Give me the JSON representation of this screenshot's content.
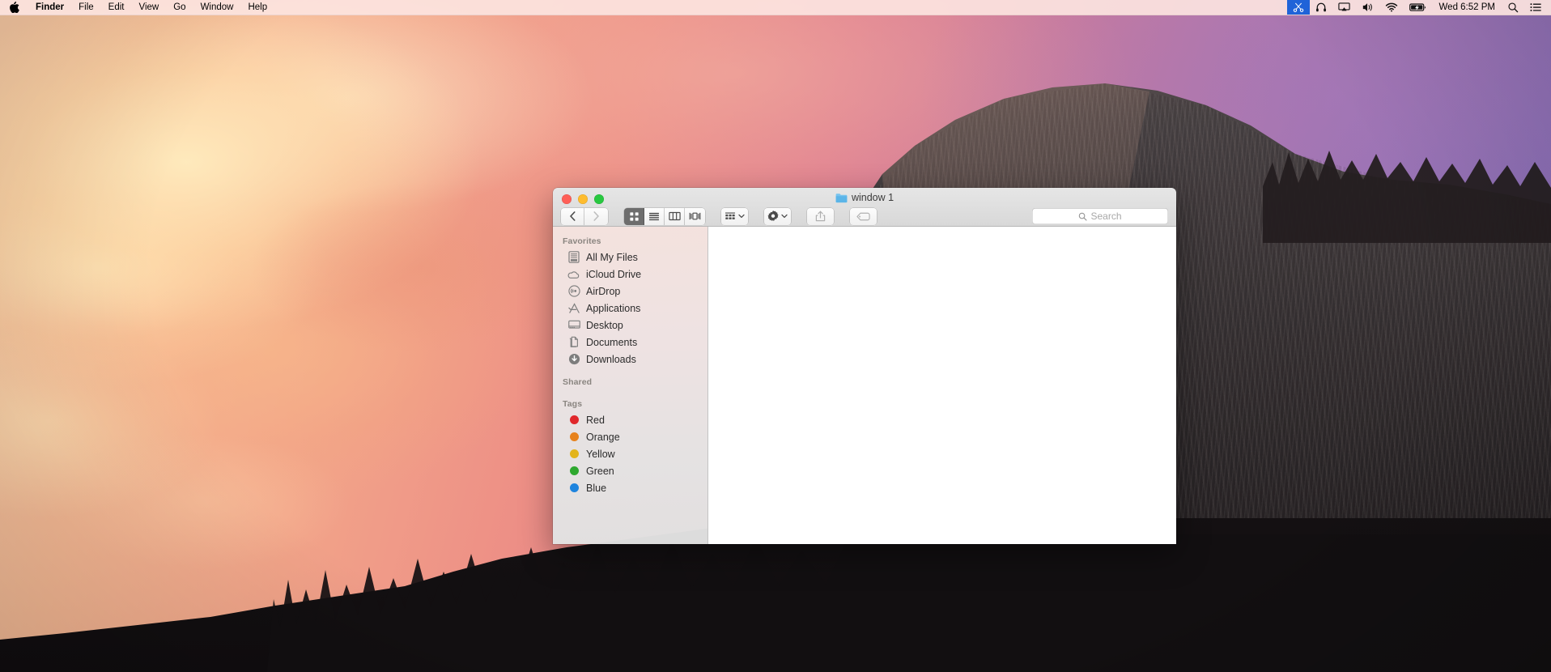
{
  "menubar": {
    "apple_glyph": "",
    "items": [
      {
        "label": "Finder",
        "bold": true
      },
      {
        "label": "File",
        "bold": false
      },
      {
        "label": "Edit",
        "bold": false
      },
      {
        "label": "View",
        "bold": false
      },
      {
        "label": "Go",
        "bold": false
      },
      {
        "label": "Window",
        "bold": false
      },
      {
        "label": "Help",
        "bold": false
      }
    ],
    "status_icons": [
      {
        "name": "scissors-icon",
        "highlighted": true
      },
      {
        "name": "headphones-icon",
        "highlighted": false
      },
      {
        "name": "airplay-display-icon",
        "highlighted": false
      },
      {
        "name": "volume-icon",
        "highlighted": false
      },
      {
        "name": "wifi-icon",
        "highlighted": false
      },
      {
        "name": "battery-charging-icon",
        "highlighted": false
      }
    ],
    "clock": "Wed 6:52 PM",
    "spotlight_icon": "search-icon",
    "notification_center_icon": "list-lines-icon",
    "background_color": "#FCE4DF",
    "highlight_color": "#1F63D8"
  },
  "window": {
    "title": "window 1",
    "title_icon": "blue-folder-icon",
    "traffic_lights": [
      {
        "name": "close-button",
        "color": "#FF5F57"
      },
      {
        "name": "minimize-button",
        "color": "#FEBC2E"
      },
      {
        "name": "zoom-button",
        "color": "#28C840"
      }
    ],
    "toolbar": {
      "back_label": "Back",
      "forward_label": "Forward",
      "back_enabled": true,
      "forward_enabled": false,
      "view_buttons": [
        {
          "name": "icon-view-button",
          "label": "Icon View",
          "selected": true
        },
        {
          "name": "list-view-button",
          "label": "List View",
          "selected": false
        },
        {
          "name": "column-view-button",
          "label": "Column View",
          "selected": false
        },
        {
          "name": "coverflow-view-button",
          "label": "Cover Flow View",
          "selected": false
        }
      ],
      "arrange_label": "Arrange By",
      "action_label": "Action",
      "share_label": "Share",
      "tags_label": "Edit Tags",
      "share_enabled": false,
      "tags_enabled": false
    },
    "search": {
      "placeholder": "Search",
      "value": ""
    },
    "sidebar": {
      "sections": [
        {
          "header": "Favorites",
          "items": [
            {
              "label": "All My Files",
              "icon": "all-my-files-icon"
            },
            {
              "label": "iCloud Drive",
              "icon": "icloud-drive-icon"
            },
            {
              "label": "AirDrop",
              "icon": "airdrop-icon"
            },
            {
              "label": "Applications",
              "icon": "applications-icon"
            },
            {
              "label": "Desktop",
              "icon": "desktop-icon"
            },
            {
              "label": "Documents",
              "icon": "documents-icon"
            },
            {
              "label": "Downloads",
              "icon": "downloads-icon"
            }
          ]
        },
        {
          "header": "Shared",
          "items": []
        },
        {
          "header": "Tags",
          "items": [
            {
              "label": "Red",
              "icon": "tag-dot-icon",
              "color": "#E0272B"
            },
            {
              "label": "Orange",
              "icon": "tag-dot-icon",
              "color": "#E7821C"
            },
            {
              "label": "Yellow",
              "icon": "tag-dot-icon",
              "color": "#E3B41A"
            },
            {
              "label": "Green",
              "icon": "tag-dot-icon",
              "color": "#2EA82E"
            },
            {
              "label": "Blue",
              "icon": "tag-dot-icon",
              "color": "#1E84DE"
            }
          ]
        }
      ]
    },
    "content": {
      "empty": true,
      "items": []
    }
  }
}
